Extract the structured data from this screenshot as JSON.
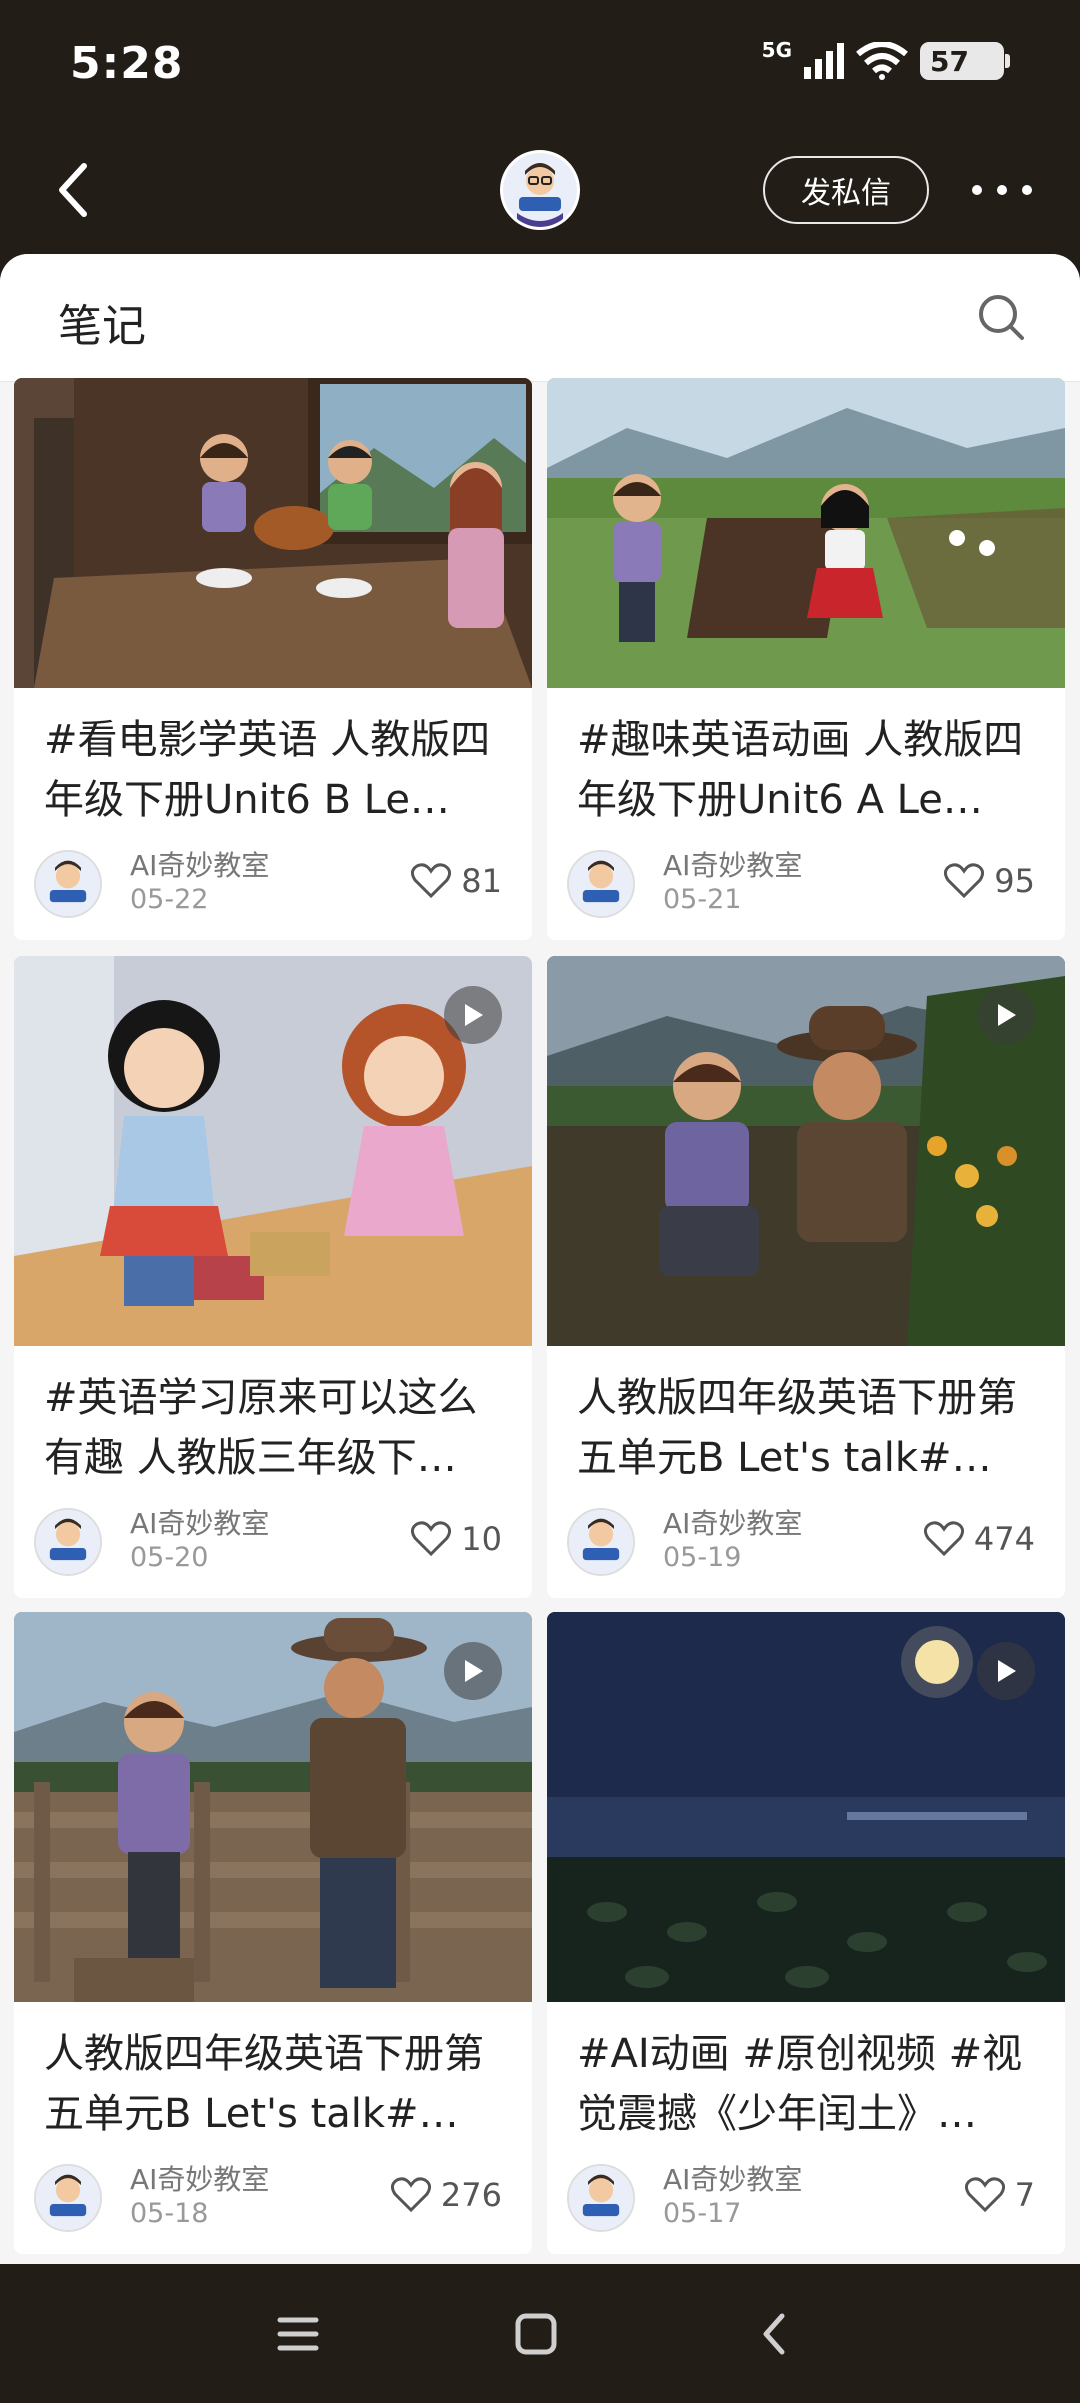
{
  "status": {
    "time": "5:28",
    "network": "5G",
    "battery": "57"
  },
  "header": {
    "message_label": "发私信"
  },
  "section": {
    "title": "笔记"
  },
  "notes": [
    {
      "title": "#看电影学英语 人教版四年级下册Unit6 B Le…",
      "author": "AI奇妙教室",
      "date": "05-22",
      "likes": "81",
      "video": false
    },
    {
      "title": "#趣味英语动画 人教版四年级下册Unit6 A Le…",
      "author": "AI奇妙教室",
      "date": "05-21",
      "likes": "95",
      "video": false
    },
    {
      "title": "#英语学习原来可以这么有趣 人教版三年级下…",
      "author": "AI奇妙教室",
      "date": "05-20",
      "likes": "10",
      "video": true
    },
    {
      "title": "人教版四年级英语下册第五单元B Let's talk#…",
      "author": "AI奇妙教室",
      "date": "05-19",
      "likes": "474",
      "video": true
    },
    {
      "title": "人教版四年级英语下册第五单元B Let's talk#…",
      "author": "AI奇妙教室",
      "date": "05-18",
      "likes": "276",
      "video": true
    },
    {
      "title": "#AI动画 #原创视频 #视觉震撼《少年闰土》…",
      "author": "AI奇妙教室",
      "date": "05-17",
      "likes": "7",
      "video": true
    }
  ]
}
